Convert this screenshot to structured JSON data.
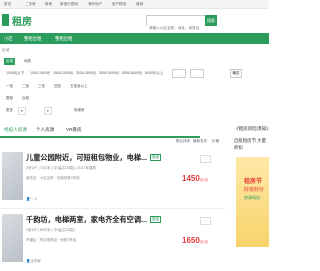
{
  "topbar": {
    "items": [
      "首页",
      "二手房",
      "新房",
      "新浪乐居网",
      "海外地产",
      "家产精选",
      "营销",
      "房产",
      "营销"
    ]
  },
  "header": {
    "brand": "租房",
    "search_placeholder": "请输入小区名称、地址、地铁站",
    "search_button": "搜索"
  },
  "nav": {
    "items": [
      "小区",
      "整租出租",
      "整租出租"
    ]
  },
  "filter": {
    "crumb": "区域",
    "row1": [
      "区域",
      "地铁"
    ],
    "rent_label": "租金",
    "rent_options": [
      "1000元以下",
      "1000-1500元",
      "1500-2000元",
      "2000-3000元",
      "3000-5000元",
      "5000-8000元",
      "8000元以上"
    ],
    "custom_sep": "-",
    "custom_btn": "确定",
    "room_label": "户型",
    "room_options": [
      "一室",
      "二室",
      "三室",
      "四室",
      "五室及以上"
    ],
    "type_label": "类型",
    "type_options": [
      "整租",
      "合租"
    ],
    "more_label": "更多",
    "more_options": [
      "精装修",
      "电梯房"
    ]
  },
  "tabs": {
    "items": [
      "全部",
      "经纪人房源",
      "个人房源",
      "VR看房"
    ]
  },
  "sort": {
    "items": [
      "默认排序",
      "最新发布",
      "价格"
    ]
  },
  "listings": [
    {
      "title": "儿童公园附近，可短租包物业，电梯...",
      "tag": "整租",
      "meta1": "2室1厅 | 74平米 | 中/高(共18层) | 2017年建筑",
      "meta2": "雨花区 · 小区名称 · 仿制地铁2号线",
      "price": "1450",
      "unit": "元/月",
      "agent": "一人",
      "fav": "收藏"
    },
    {
      "title": "千韵坊，电梯两室，家电齐全有空调...",
      "tag": "整租",
      "meta1": "2室1厅 | 68平米 | 中/高(共16层)",
      "meta2": "开福区 · 附近地铁站 · 地铁1号线",
      "price": "1650",
      "unit": "元/月",
      "agent": "企学家",
      "fav": "收藏"
    }
  ],
  "sidebar": {
    "title": "《租房风险须知》",
    "sub1": "启航租房节 大量",
    "sub2": "折扣",
    "ad_line1": "租房节",
    "ad_line2": "好房好价",
    "ad_line3": "房源网站"
  }
}
